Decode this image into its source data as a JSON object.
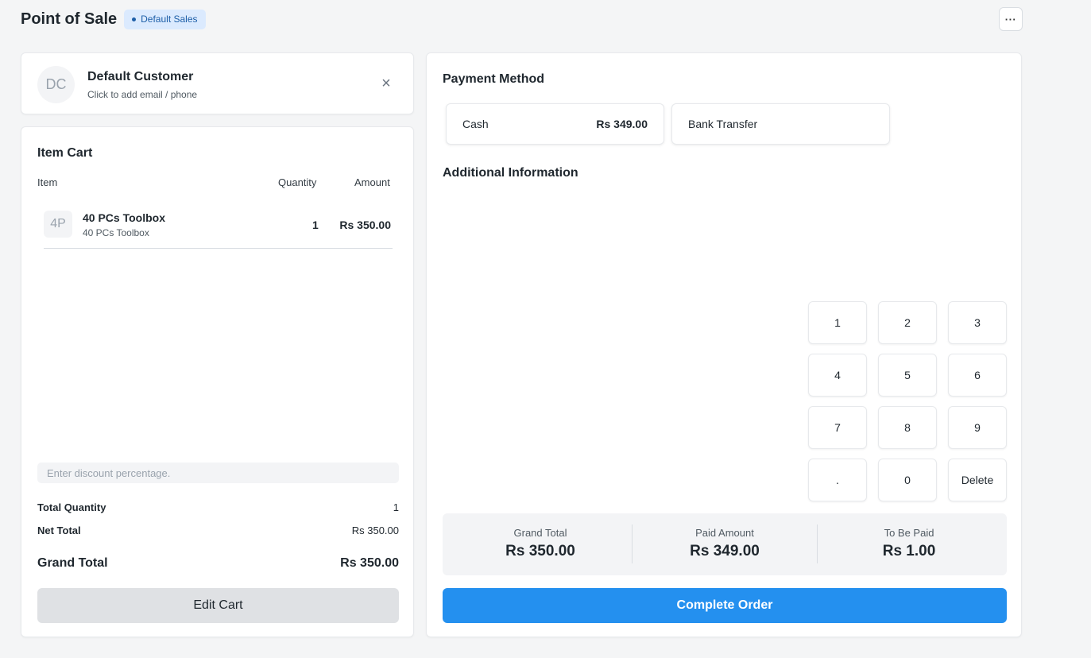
{
  "header": {
    "title": "Point of Sale",
    "profile_badge": "Default Sales",
    "more_label": "···"
  },
  "customer": {
    "initials": "DC",
    "name": "Default Customer",
    "subtitle": "Click to add email / phone",
    "close_icon": "×"
  },
  "cart": {
    "title": "Item Cart",
    "columns": {
      "item": "Item",
      "quantity": "Quantity",
      "amount": "Amount"
    },
    "items": [
      {
        "initials": "4P",
        "name": "40 PCs Toolbox",
        "description": "40 PCs Toolbox",
        "qty": "1",
        "amount": "Rs 350.00"
      }
    ],
    "discount_placeholder": "Enter discount percentage.",
    "summary": {
      "total_qty_label": "Total Quantity",
      "total_qty": "1",
      "net_total_label": "Net Total",
      "net_total": "Rs 350.00",
      "grand_total_label": "Grand Total",
      "grand_total": "Rs 350.00"
    },
    "edit_label": "Edit Cart"
  },
  "payment": {
    "title": "Payment Method",
    "methods": [
      {
        "name": "Cash",
        "amount": "Rs 349.00"
      },
      {
        "name": "Bank Transfer",
        "amount": ""
      }
    ],
    "additional_title": "Additional Information",
    "keypad": [
      "1",
      "2",
      "3",
      "4",
      "5",
      "6",
      "7",
      "8",
      "9",
      ".",
      "0",
      "Delete"
    ],
    "totals": {
      "grand_label": "Grand Total",
      "grand": "Rs 350.00",
      "paid_label": "Paid Amount",
      "paid": "Rs 349.00",
      "due_label": "To Be Paid",
      "due": "Rs 1.00"
    },
    "complete_label": "Complete Order"
  },
  "colors": {
    "primary": "#2490ef",
    "badge_bg": "#dbeafe",
    "badge_text": "#1e5fa8",
    "background": "#f4f5f6"
  }
}
